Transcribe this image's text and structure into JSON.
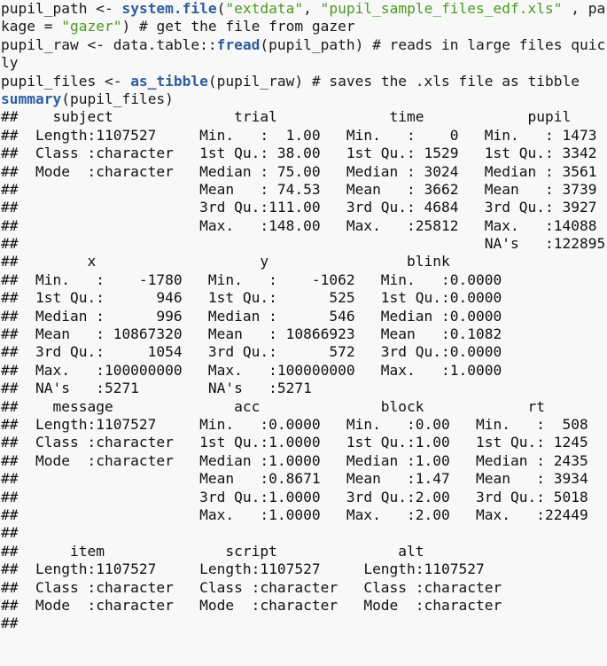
{
  "code": {
    "lines": [
      [
        {
          "t": "pupil_path <- ",
          "c": ""
        },
        {
          "t": "system.file",
          "c": "fn"
        },
        {
          "t": "(",
          "c": ""
        },
        {
          "t": "\"extdata\"",
          "c": "str"
        },
        {
          "t": ", ",
          "c": ""
        },
        {
          "t": "\"pupil_sample_files_edf.xls\"",
          "c": "str"
        },
        {
          "t": " , pac",
          "c": ""
        }
      ],
      [
        {
          "t": "kage = ",
          "c": ""
        },
        {
          "t": "\"gazer\"",
          "c": "str"
        },
        {
          "t": ") # get the file from gazer",
          "c": ""
        }
      ],
      [
        {
          "t": "pupil_raw <- data.table::",
          "c": ""
        },
        {
          "t": "fread",
          "c": "fn"
        },
        {
          "t": "(pupil_path) # reads in large files quick",
          "c": ""
        }
      ],
      [
        {
          "t": "ly",
          "c": ""
        }
      ],
      [
        {
          "t": "pupil_files <- ",
          "c": ""
        },
        {
          "t": "as_tibble",
          "c": "fn"
        },
        {
          "t": "(pupil_raw) # saves the .xls file as tibble",
          "c": ""
        }
      ],
      [
        {
          "t": "summary",
          "c": "fn"
        },
        {
          "t": "(pupil_files)",
          "c": ""
        }
      ]
    ]
  },
  "output": {
    "lines": [
      "##    subject              trial             time            pupil     ",
      "##  Length:1107527     Min.   :  1.00   Min.   :    0   Min.   : 1473  ",
      "##  Class :character   1st Qu.: 38.00   1st Qu.: 1529   1st Qu.: 3342  ",
      "##  Mode  :character   Median : 75.00   Median : 3024   Median : 3561  ",
      "##                     Mean   : 74.53   Mean   : 3662   Mean   : 3739  ",
      "##                     3rd Qu.:111.00   3rd Qu.: 4684   3rd Qu.: 3927  ",
      "##                     Max.   :148.00   Max.   :25812   Max.   :14088  ",
      "##                                                      NA's   :122895 ",
      "##        x                   y                blink       ",
      "##  Min.   :    -1780   Min.   :    -1062   Min.   :0.0000  ",
      "##  1st Qu.:      946   1st Qu.:      525   1st Qu.:0.0000  ",
      "##  Median :      996   Median :      546   Median :0.0000  ",
      "##  Mean   : 10867320   Mean   : 10866923   Mean   :0.1082  ",
      "##  3rd Qu.:     1054   3rd Qu.:      572   3rd Qu.:0.0000  ",
      "##  Max.   :100000000   Max.   :100000000   Max.   :1.0000  ",
      "##  NA's   :5271        NA's   :5271                        ",
      "##    message              acc              block            rt       ",
      "##  Length:1107527     Min.   :0.0000   Min.   :0.00   Min.   :  508  ",
      "##  Class :character   1st Qu.:1.0000   1st Qu.:1.00   1st Qu.: 1245  ",
      "##  Mode  :character   Median :1.0000   Median :1.00   Median : 2435  ",
      "##                     Mean   :0.8671   Mean   :1.47   Mean   : 3934  ",
      "##                     3rd Qu.:1.0000   3rd Qu.:2.00   3rd Qu.: 5018  ",
      "##                     Max.   :1.0000   Max.   :2.00   Max.   :22449  ",
      "##                                                                    ",
      "##      item              script              alt           ",
      "##  Length:1107527     Length:1107527     Length:1107527    ",
      "##  Class :character   Class :character   Class :character  ",
      "##  Mode  :character   Mode  :character   Mode  :character  ",
      "## "
    ]
  },
  "colors": {
    "background": "#f8f8f8",
    "function": "#2e5e9e",
    "string": "#4a9a1e",
    "text": "#1a1a1a"
  }
}
